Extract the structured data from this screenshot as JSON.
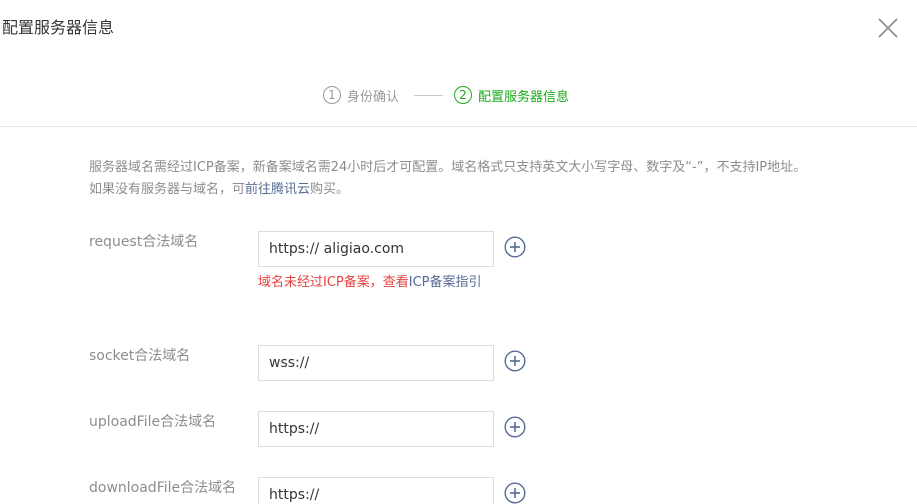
{
  "dialog": {
    "title": "配置服务器信息"
  },
  "steps": [
    {
      "num": "1",
      "label": "身份确认",
      "state": "done"
    },
    {
      "num": "2",
      "label": "配置服务器信息",
      "state": "active"
    }
  ],
  "colors": {
    "active_green": "#1aad19",
    "link_blue": "#576b95",
    "error_red": "#e64340",
    "muted_gray": "#8d8d8d"
  },
  "notice": {
    "text_before": "服务器域名需经过ICP备案，新备案域名需24小时后才可配置。域名格式只支持英文大小写字母、数字及“-”，不支持IP地址。如果没有服务器与域名，可",
    "link": "前往腾讯云",
    "text_after": "购买。"
  },
  "fields": [
    {
      "label": "request合法域名",
      "value": "https:// aligiao.com",
      "placeholder": ""
    },
    {
      "label": "socket合法域名",
      "value": "wss://",
      "placeholder": ""
    },
    {
      "label": "uploadFile合法域名",
      "value": "https://",
      "placeholder": ""
    },
    {
      "label": "downloadFile合法域名",
      "value": "https://",
      "placeholder": ""
    }
  ],
  "error": {
    "text": "域名未经过ICP备案，查看",
    "link": "ICP备案指引"
  },
  "icons": {
    "close": "close-icon",
    "add": "plus-circle-icon"
  }
}
